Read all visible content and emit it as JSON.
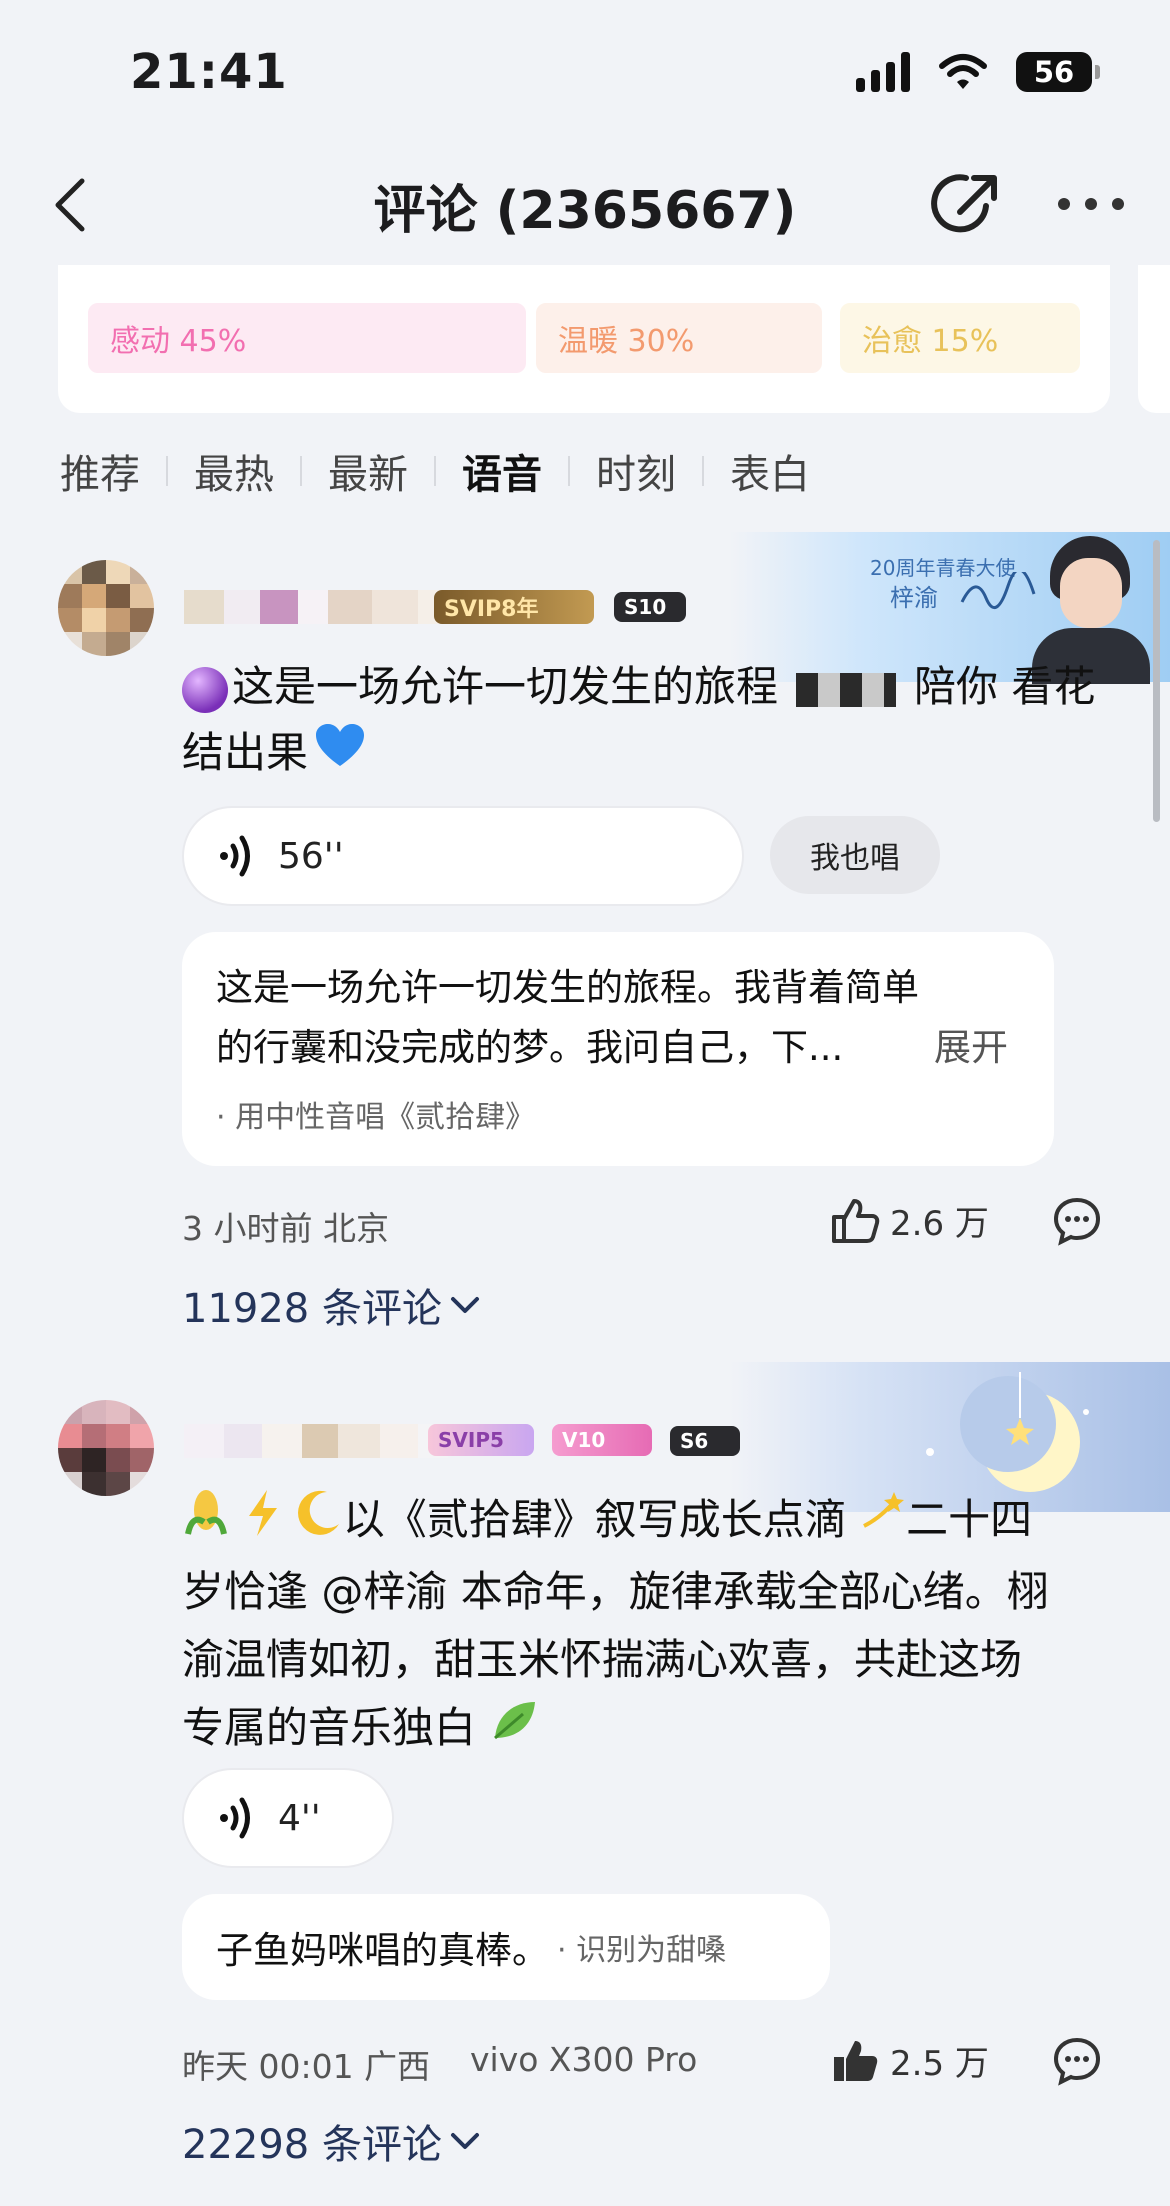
{
  "status_bar": {
    "time": "21:41",
    "battery": "56"
  },
  "header": {
    "title": "评论 (2365667)"
  },
  "mood_tags": [
    {
      "label": "感动 45%",
      "color": "#f26fb0",
      "bg": "#fdeaf3"
    },
    {
      "label": "温暖 30%",
      "color": "#f39a6e",
      "bg": "#fdf0ea"
    },
    {
      "label": "治愈 15%",
      "color": "#e8c25a",
      "bg": "#fdf7e6"
    }
  ],
  "tabs": [
    "推荐",
    "最热",
    "最新",
    "语音",
    "时刻",
    "表白"
  ],
  "active_tab": "语音",
  "comments": [
    {
      "banner_text": "20周年青春大使",
      "banner_name": "梓渝",
      "badges": [
        "SVIP8年",
        "S10"
      ],
      "text": "这是一场允许一切发生的旅程",
      "text_tail": "陪你 看花结出果",
      "audio_duration": "56''",
      "sing_label": "我也唱",
      "lyric_line1": "这是一场允许一切发生的旅程。我背着简单",
      "lyric_line2": "的行囊和没完成的梦。我问自己，下...",
      "expand_label": "展开",
      "lyric_note": "· 用中性音唱《贰拾肆》",
      "time_location": "3 小时前 北京",
      "likes": "2.6 万",
      "reply_count": "11928 条评论"
    },
    {
      "badges": [
        "SVIP5",
        "V10",
        "S6"
      ],
      "text_lines": [
        "以《贰拾肆》叙写成长点滴",
        "二十四",
        "岁恰逢 @梓渝 本命年，旋律承载全部心绪。栩",
        "渝温情如初，甜玉米怀揣满心欢喜，共赴这场",
        "专属的音乐独白"
      ],
      "audio_duration": "4''",
      "voice_text": "子鱼妈咪唱的真棒。",
      "voice_note": "· 识别为甜嗓",
      "time_location": "昨天 00:01 广西",
      "device": "vivo X300 Pro",
      "likes": "2.5 万",
      "reply_count": "22298 条评论"
    }
  ]
}
